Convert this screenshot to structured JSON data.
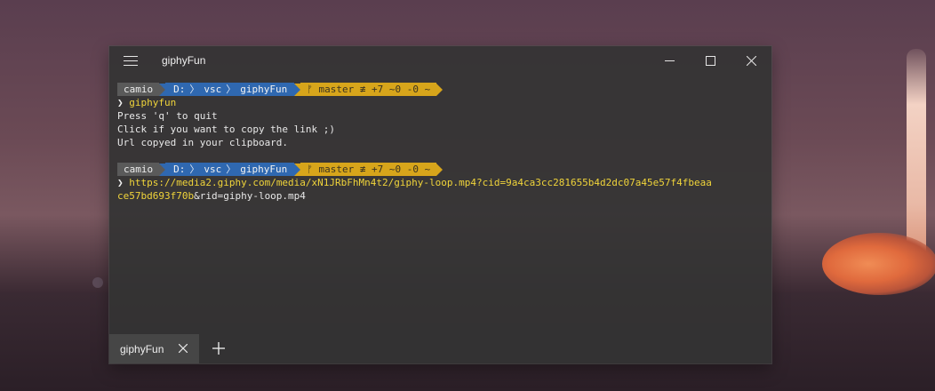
{
  "window": {
    "title": "giphyFun"
  },
  "terminal": {
    "prompt1": {
      "user": "camio",
      "path": [
        "D:",
        "vsc",
        "giphyFun"
      ],
      "git": "ᚠ master ≢ +7 ~0 -0 ~"
    },
    "lines1": [
      "giphyfun",
      "Press 'q' to quit",
      "Click if you want to copy the link ;)",
      "Url copyed in your clipboard."
    ],
    "prompt2": {
      "user": "camio",
      "path": [
        "D:",
        "vsc",
        "giphyFun"
      ],
      "git": "ᚠ master ≢ +7 ~0 -0 ~"
    },
    "url_line1": "https://media2.giphy.com/media/xN1JRbFhMn4t2/giphy-loop.mp4?cid=9a4ca3cc281655b4d2dc07a45e57f4fbeaa",
    "url_line2_hl": "ce57bd693f70b",
    "url_line2_rest": "&rid=giphy-loop.mp4",
    "prompt_char": "❯"
  },
  "tabs": [
    {
      "label": "giphyFun"
    }
  ],
  "colors": {
    "prompt_user": "#5a5a5a",
    "prompt_path": "#2f68b0",
    "prompt_git": "#d7a51b",
    "command": "#f0d43a"
  },
  "icons": {
    "menu": "hamburger-icon",
    "minimize": "minimize-icon",
    "maximize": "maximize-icon",
    "close": "close-icon",
    "tab_close": "close-icon",
    "new_tab": "plus-icon"
  }
}
